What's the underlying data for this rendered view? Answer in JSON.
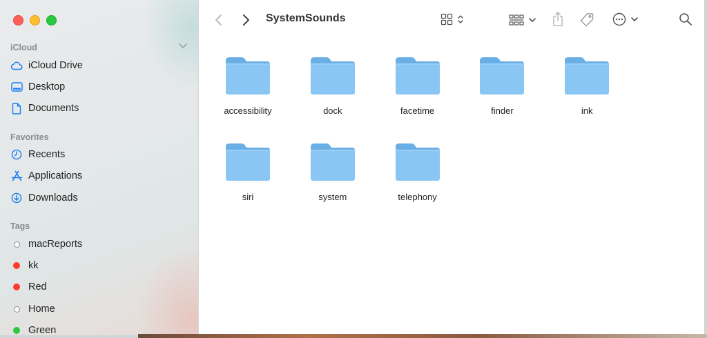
{
  "window": {
    "title": "SystemSounds"
  },
  "sidebar": {
    "sections": {
      "icloud": "iCloud",
      "favorites": "Favorites",
      "tags": "Tags"
    },
    "icloud_items": [
      {
        "label": "iCloud Drive",
        "icon": "cloud-icon"
      },
      {
        "label": "Desktop",
        "icon": "desktop-icon"
      },
      {
        "label": "Documents",
        "icon": "document-icon"
      }
    ],
    "favorites_items": [
      {
        "label": "Recents",
        "icon": "clock-icon"
      },
      {
        "label": "Applications",
        "icon": "applications-icon"
      },
      {
        "label": "Downloads",
        "icon": "download-icon"
      }
    ],
    "tags_items": [
      {
        "label": "macReports",
        "color": "#ffffff"
      },
      {
        "label": "kk",
        "color": "#ff3b30"
      },
      {
        "label": "Red",
        "color": "#ff3b30"
      },
      {
        "label": "Home",
        "color": "#ffffff"
      },
      {
        "label": "Green",
        "color": "#28c840"
      }
    ]
  },
  "folders": [
    {
      "name": "accessibility"
    },
    {
      "name": "dock"
    },
    {
      "name": "facetime"
    },
    {
      "name": "finder"
    },
    {
      "name": "ink"
    },
    {
      "name": "siri"
    },
    {
      "name": "system"
    },
    {
      "name": "telephony"
    }
  ],
  "colors": {
    "accent": "#1a7cf5",
    "folder_front": "#89c6f4",
    "folder_back": "#6aaee6"
  }
}
